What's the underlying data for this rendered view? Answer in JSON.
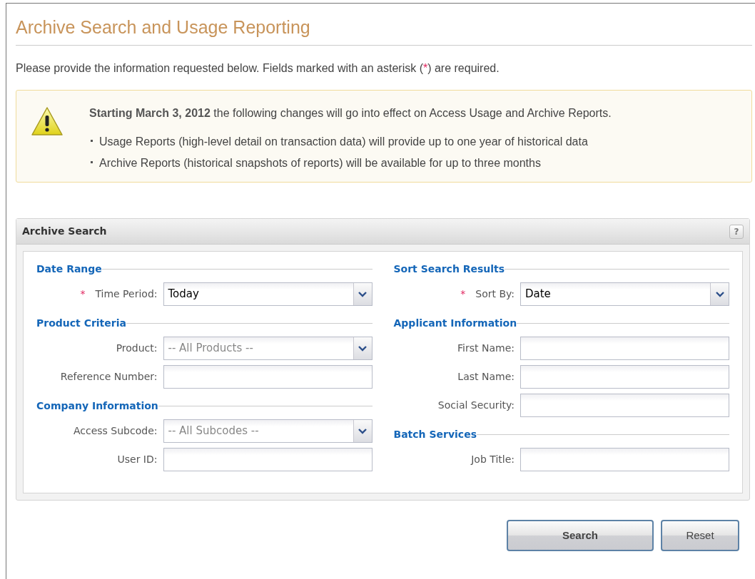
{
  "page": {
    "title": "Archive Search and Usage Reporting",
    "intro": {
      "before": "Please provide the information requested below. Fields marked with an asterisk (",
      "mark": "*",
      "after": ") are required."
    }
  },
  "notice": {
    "lead": "**Starting March 3, 2012** the following changes will go into effect on Access Usage and Archive Reports.",
    "bullets": [
      "Usage Reports (high-level detail on transaction data) will provide up to one year of historical data",
      "Archive Reports (historical snapshots of reports) will be available for up to three months"
    ]
  },
  "panel": {
    "title": "Archive Search",
    "help": "?",
    "columns": [
      {
        "sections": [
          {
            "heading": "Date Range",
            "fields": [
              {
                "kind": "select",
                "label": "Time Period:",
                "required": true,
                "value": "Today"
              }
            ]
          },
          {
            "heading": "Product Criteria",
            "fields": [
              {
                "kind": "select",
                "label": "Product:",
                "required": false,
                "placeholder": "-- All Products --"
              },
              {
                "kind": "text",
                "label": "Reference Number:",
                "required": false
              }
            ]
          },
          {
            "heading": "Company Information",
            "fields": [
              {
                "kind": "select",
                "label": "Access Subcode:",
                "required": false,
                "placeholder": "-- All Subcodes --"
              },
              {
                "kind": "text",
                "label": "User ID:",
                "required": false
              }
            ]
          }
        ]
      },
      {
        "sections": [
          {
            "heading": "Sort Search Results",
            "fields": [
              {
                "kind": "select",
                "label": "Sort By:",
                "required": true,
                "value": "Date"
              }
            ]
          },
          {
            "heading": "Applicant Information",
            "fields": [
              {
                "kind": "text",
                "label": "First Name:",
                "required": false
              },
              {
                "kind": "text",
                "label": "Last Name:",
                "required": false
              },
              {
                "kind": "text",
                "label": "Social Security:",
                "required": false
              }
            ]
          },
          {
            "heading": "Batch Services",
            "fields": [
              {
                "kind": "text",
                "label": "Job Title:",
                "required": false
              }
            ]
          }
        ]
      }
    ]
  },
  "buttons": [
    {
      "label": "Search",
      "primary": true
    },
    {
      "label": "Reset",
      "primary": false
    }
  ]
}
